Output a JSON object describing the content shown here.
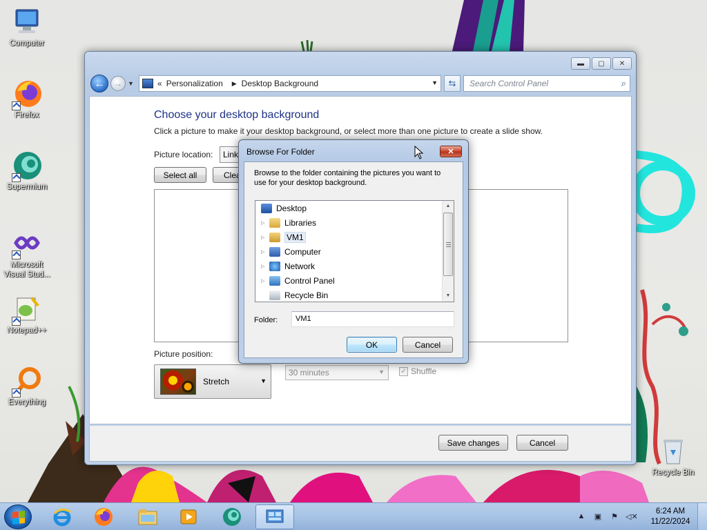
{
  "desktop": {
    "icons": [
      {
        "label": "Computer"
      },
      {
        "label": "Firefox"
      },
      {
        "label": "Supermium"
      },
      {
        "label": "Microsoft Visual Stud..."
      },
      {
        "label": "Notepad++"
      },
      {
        "label": "Everything"
      },
      {
        "label": "Recycle Bin"
      }
    ]
  },
  "window": {
    "breadcrumb": {
      "prefix": "«",
      "items": [
        "Personalization",
        "Desktop Background"
      ]
    },
    "search_placeholder": "Search Control Panel",
    "heading": "Choose your desktop background",
    "description": "Click a picture to make it your desktop background, or select more than one picture to create a slide show.",
    "picture_location_label": "Picture location:",
    "picture_location_value": "Link",
    "select_all_label": "Select all",
    "clear_all_label": "Clea",
    "picture_position_label": "Picture position:",
    "picture_position_value": "Stretch",
    "interval_value": "30 minutes",
    "shuffle_label": "Shuffle",
    "save_label": "Save changes",
    "cancel_label": "Cancel"
  },
  "dialog": {
    "title": "Browse For Folder",
    "close_glyph": "✕",
    "message": "Browse to the folder containing the pictures you want to use for your desktop background.",
    "tree": [
      {
        "label": "Desktop",
        "icon": "desktop-icon",
        "color": "#3b6ec2"
      },
      {
        "label": "Libraries",
        "icon": "libraries-icon",
        "color": "#e8c15a"
      },
      {
        "label": "VM1",
        "icon": "user-folder-icon",
        "color": "#e3b84a",
        "selected": true
      },
      {
        "label": "Computer",
        "icon": "computer-icon",
        "color": "#4f7fc9"
      },
      {
        "label": "Network",
        "icon": "network-icon",
        "color": "#2f6fb8"
      },
      {
        "label": "Control Panel",
        "icon": "control-panel-icon",
        "color": "#4a90d0"
      },
      {
        "label": "Recycle Bin",
        "icon": "recycle-bin-icon",
        "color": "#9aa6b2"
      }
    ],
    "folder_label": "Folder:",
    "folder_value": "VM1",
    "ok_label": "OK",
    "cancel_label": "Cancel"
  },
  "taskbar": {
    "apps": [
      "internet-explorer-icon",
      "firefox-icon",
      "file-explorer-icon",
      "media-player-icon",
      "supermium-icon",
      "control-panel-icon"
    ],
    "time": "6:24 AM",
    "date": "11/22/2024"
  }
}
